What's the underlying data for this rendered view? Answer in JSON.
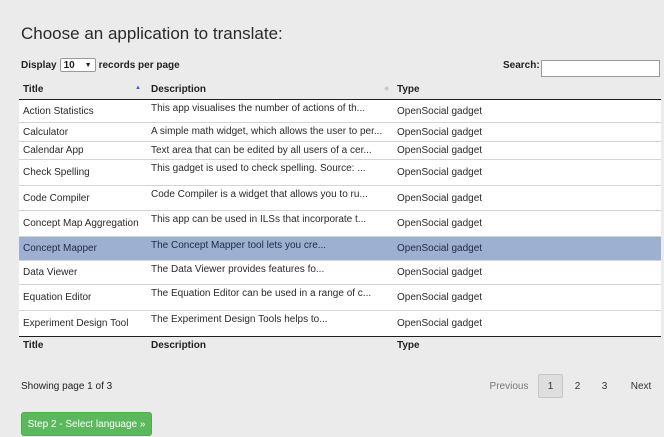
{
  "page": {
    "title": "Choose an application to translate:"
  },
  "length_control": {
    "prefix": "Display",
    "selected": "10",
    "suffix": "records per page"
  },
  "search": {
    "label": "Search:",
    "value": ""
  },
  "table": {
    "columns": [
      "Title",
      "Description",
      "Type"
    ],
    "sort": {
      "column": "Title",
      "direction": "ascending"
    },
    "rows": [
      {
        "title": "Action Statistics",
        "description": "This app visualises the number of actions of th...",
        "type": "OpenSocial gadget"
      },
      {
        "title": "Calculator",
        "description": "A simple math widget, which allows the user to per...",
        "type": "OpenSocial gadget"
      },
      {
        "title": "Calendar App",
        "description": "Text area that can be edited by all users of a cer...",
        "type": "OpenSocial gadget"
      },
      {
        "title": "Check Spelling",
        "description": "This gadget is used to check spelling. Source: ...",
        "type": "OpenSocial gadget"
      },
      {
        "title": "Code Compiler",
        "description": "Code Compiler is a widget that allows you to ru...",
        "type": "OpenSocial gadget"
      },
      {
        "title": "Concept Map Aggregation",
        "description": "This app can be used in ILSs that incorporate t...",
        "type": "OpenSocial gadget"
      },
      {
        "title": "Concept Mapper",
        "description": "The Concept Mapper tool lets you cre...",
        "type": "OpenSocial gadget",
        "selected": true
      },
      {
        "title": "Data Viewer",
        "description": "The Data Viewer provides features fo...",
        "type": "OpenSocial gadget"
      },
      {
        "title": "Equation Editor",
        "description": "The Equation Editor can be used in a range of c...",
        "type": "OpenSocial gadget"
      },
      {
        "title": "Experiment Design Tool",
        "description": "The Experiment Design Tools helps to...",
        "type": "OpenSocial gadget"
      }
    ]
  },
  "info": "Showing page 1 of 3",
  "pagination": {
    "previous": "Previous",
    "pages": [
      "1",
      "2",
      "3"
    ],
    "current": "1",
    "next": "Next"
  },
  "step_button": "Step 2 - Select language »",
  "colors": {
    "background": "#ebebeb",
    "selected_row": "#9eb0d1",
    "primary_button": "#5cb85c",
    "sort_indicator": "#3b5fbf"
  }
}
